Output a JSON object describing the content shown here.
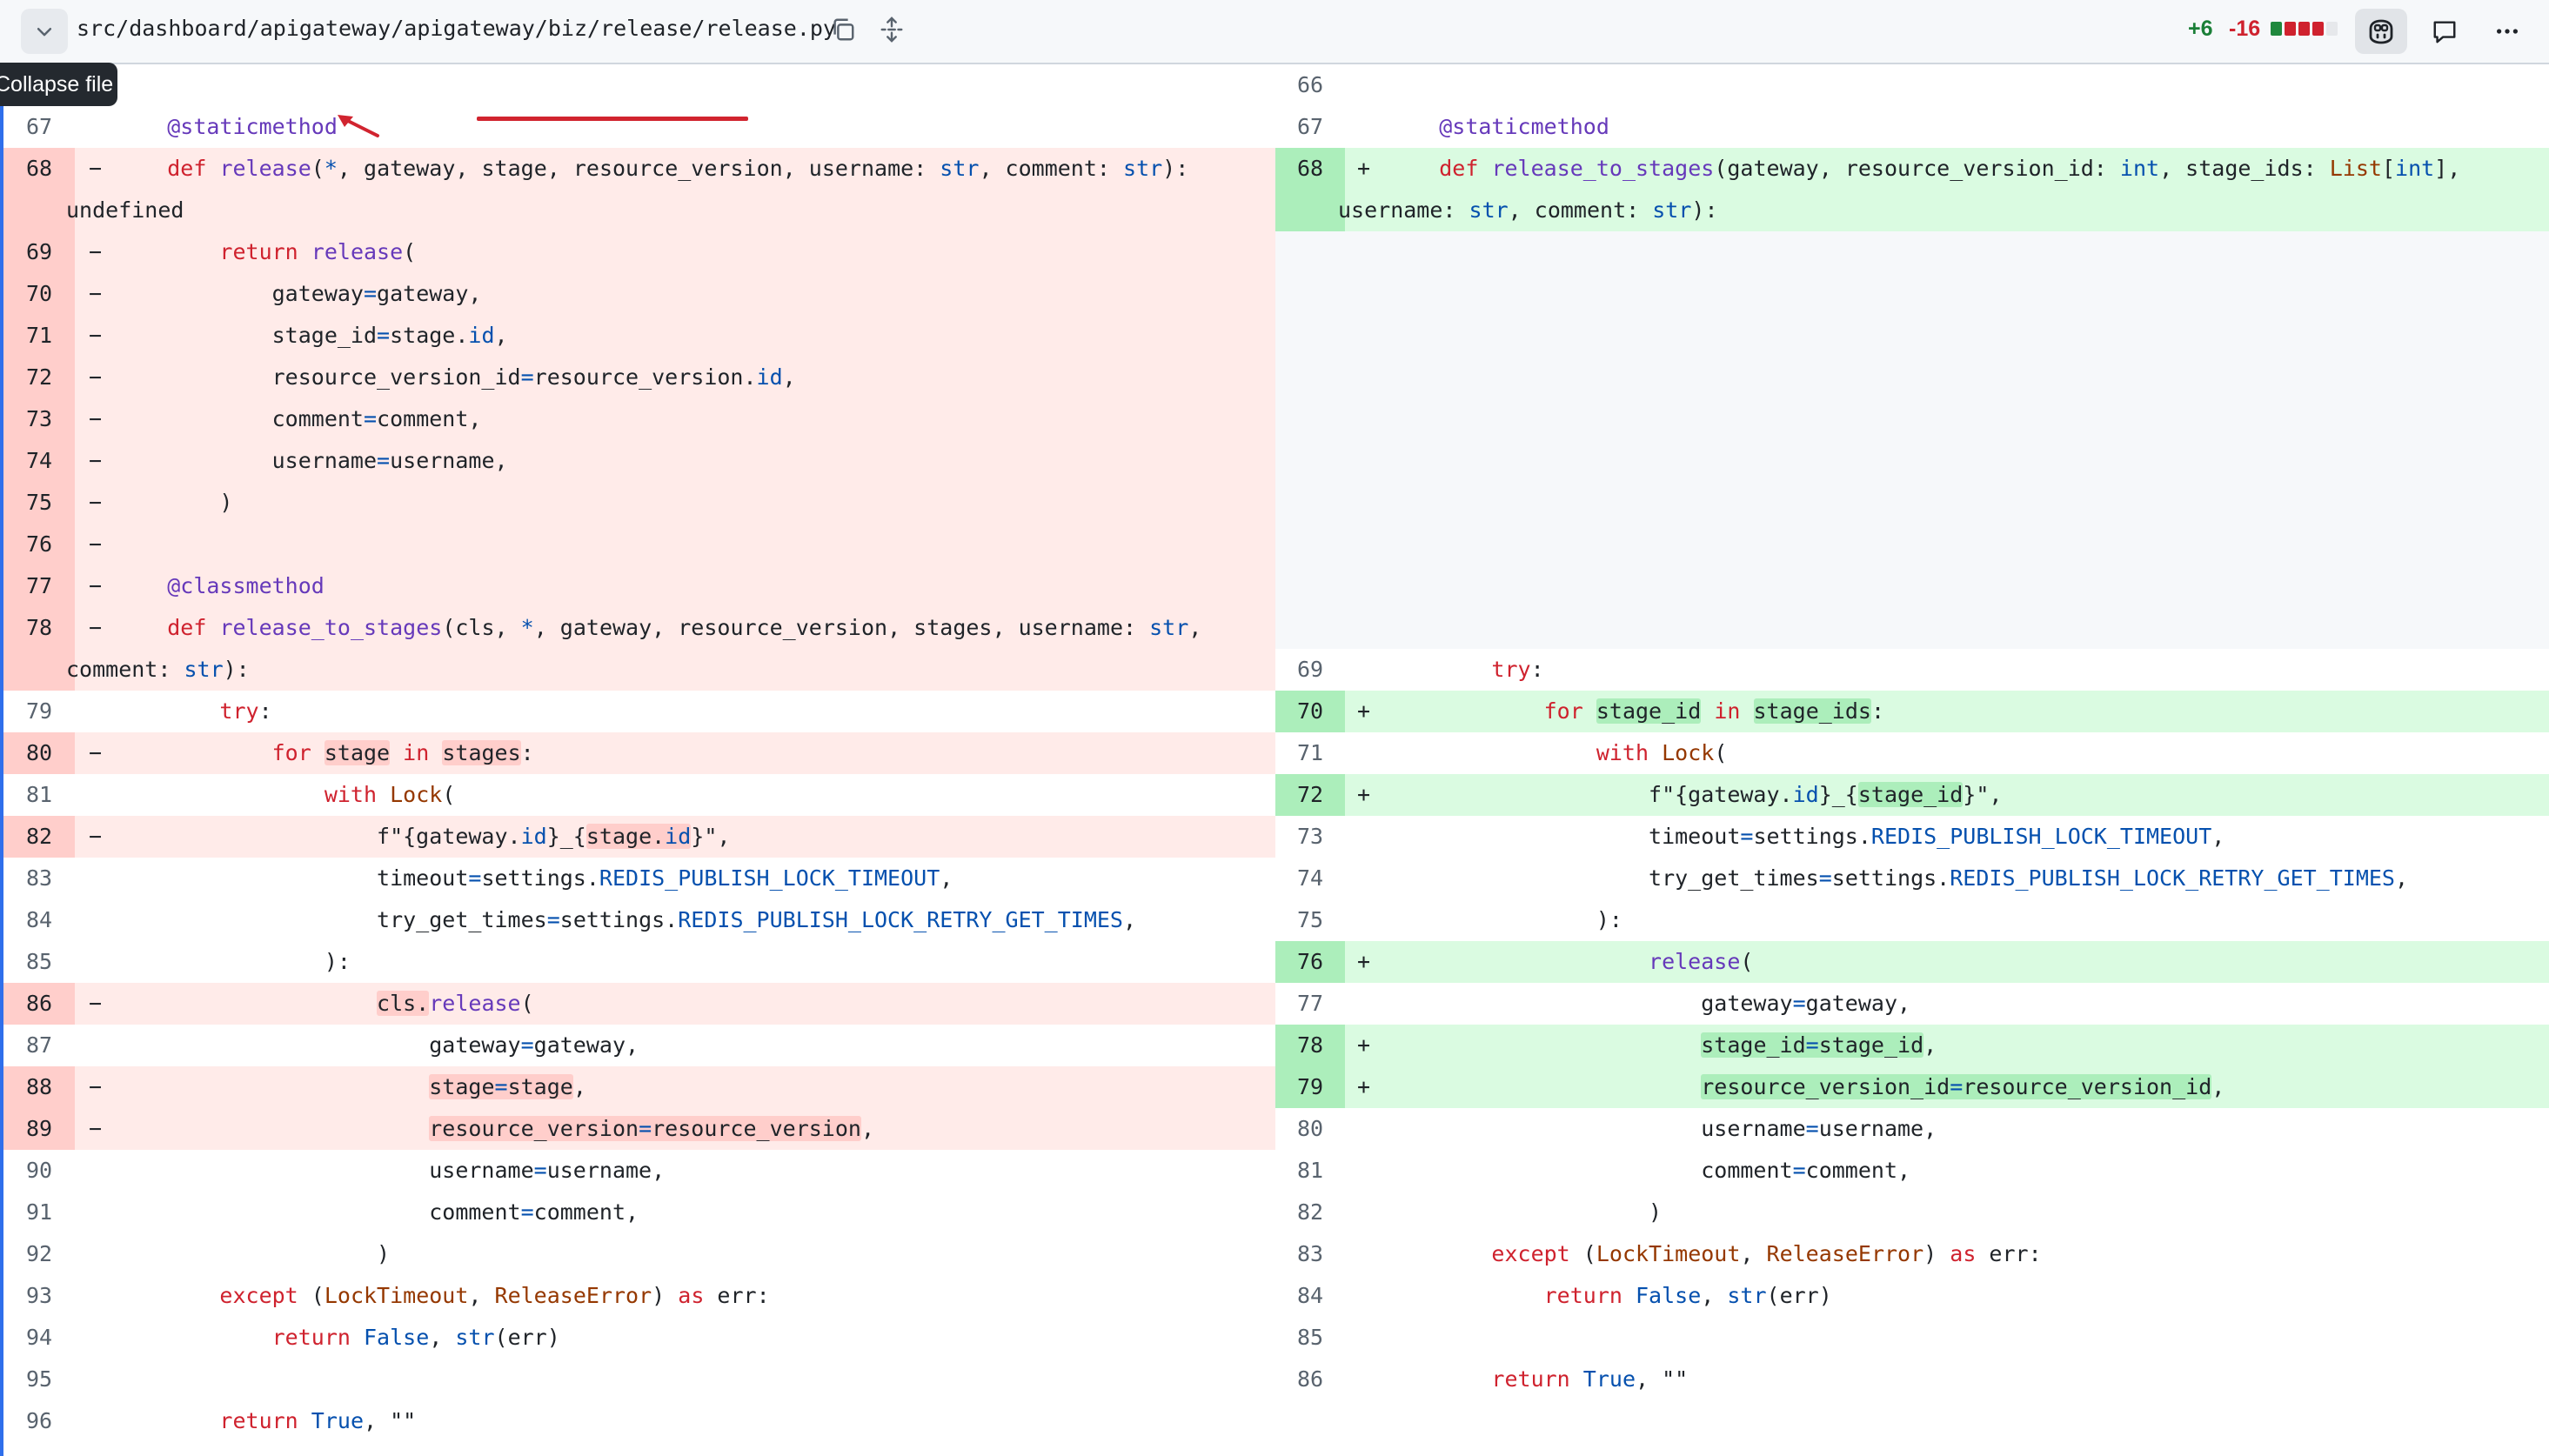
{
  "header": {
    "file_path": "src/dashboard/apigateway/apigateway/biz/release/release.py",
    "additions": "+6",
    "deletions": "-16",
    "tooltip": "Collapse file"
  },
  "left": [
    {
      "n": "",
      "m": "",
      "c": "",
      "t": "ctx"
    },
    {
      "n": "67",
      "m": "",
      "c": "    @staticmethod",
      "t": "ctx"
    },
    {
      "n": "68",
      "m": "−",
      "c": "    def release(*, gateway, stage, resource_version, username: str, comment: str):",
      "t": "del",
      "tall": true
    },
    {
      "n": "69",
      "m": "−",
      "c": "        return release(",
      "t": "del"
    },
    {
      "n": "70",
      "m": "−",
      "c": "            gateway=gateway,",
      "t": "del"
    },
    {
      "n": "71",
      "m": "−",
      "c": "            stage_id=stage.id,",
      "t": "del"
    },
    {
      "n": "72",
      "m": "−",
      "c": "            resource_version_id=resource_version.id,",
      "t": "del"
    },
    {
      "n": "73",
      "m": "−",
      "c": "            comment=comment,",
      "t": "del"
    },
    {
      "n": "74",
      "m": "−",
      "c": "            username=username,",
      "t": "del"
    },
    {
      "n": "75",
      "m": "−",
      "c": "        )",
      "t": "del"
    },
    {
      "n": "76",
      "m": "−",
      "c": "",
      "t": "del"
    },
    {
      "n": "77",
      "m": "−",
      "c": "    @classmethod",
      "t": "del"
    },
    {
      "n": "78",
      "m": "−",
      "c": "    def release_to_stages(cls, *, gateway, resource_version, stages, username: str,\ncomment: str):",
      "t": "del",
      "tall": true
    },
    {
      "n": "79",
      "m": "",
      "c": "        try:",
      "t": "ctx"
    },
    {
      "n": "80",
      "m": "−",
      "c": "            for stage in stages:",
      "t": "del"
    },
    {
      "n": "81",
      "m": "",
      "c": "                with Lock(",
      "t": "ctx"
    },
    {
      "n": "82",
      "m": "−",
      "c": "                    f\"{gateway.id}_{stage.id}\",",
      "t": "del"
    },
    {
      "n": "83",
      "m": "",
      "c": "                    timeout=settings.REDIS_PUBLISH_LOCK_TIMEOUT,",
      "t": "ctx"
    },
    {
      "n": "84",
      "m": "",
      "c": "                    try_get_times=settings.REDIS_PUBLISH_LOCK_RETRY_GET_TIMES,",
      "t": "ctx"
    },
    {
      "n": "85",
      "m": "",
      "c": "                ):",
      "t": "ctx"
    },
    {
      "n": "86",
      "m": "−",
      "c": "                    cls.release(",
      "t": "del"
    },
    {
      "n": "87",
      "m": "",
      "c": "                        gateway=gateway,",
      "t": "ctx"
    },
    {
      "n": "88",
      "m": "−",
      "c": "                        stage=stage,",
      "t": "del"
    },
    {
      "n": "89",
      "m": "−",
      "c": "                        resource_version=resource_version,",
      "t": "del"
    },
    {
      "n": "90",
      "m": "",
      "c": "                        username=username,",
      "t": "ctx"
    },
    {
      "n": "91",
      "m": "",
      "c": "                        comment=comment,",
      "t": "ctx"
    },
    {
      "n": "92",
      "m": "",
      "c": "                    )",
      "t": "ctx"
    },
    {
      "n": "93",
      "m": "",
      "c": "        except (LockTimeout, ReleaseError) as err:",
      "t": "ctx"
    },
    {
      "n": "94",
      "m": "",
      "c": "            return False, str(err)",
      "t": "ctx"
    },
    {
      "n": "95",
      "m": "",
      "c": "",
      "t": "ctx"
    },
    {
      "n": "96",
      "m": "",
      "c": "        return True, \"\"",
      "t": "ctx"
    }
  ],
  "right": [
    {
      "n": "66",
      "m": "",
      "c": "",
      "t": "ctx"
    },
    {
      "n": "67",
      "m": "",
      "c": "    @staticmethod",
      "t": "ctx"
    },
    {
      "n": "68",
      "m": "+",
      "c": "    def release_to_stages(gateway, resource_version_id: int, stage_ids: List[int],\nusername: str, comment: str):",
      "t": "add",
      "tall": true,
      "spacer_after": 10
    },
    {
      "n": "69",
      "m": "",
      "c": "        try:",
      "t": "ctx"
    },
    {
      "n": "70",
      "m": "+",
      "c": "            for stage_id in stage_ids:",
      "t": "add"
    },
    {
      "n": "71",
      "m": "",
      "c": "                with Lock(",
      "t": "ctx"
    },
    {
      "n": "72",
      "m": "+",
      "c": "                    f\"{gateway.id}_{stage_id}\",",
      "t": "add"
    },
    {
      "n": "73",
      "m": "",
      "c": "                    timeout=settings.REDIS_PUBLISH_LOCK_TIMEOUT,",
      "t": "ctx"
    },
    {
      "n": "74",
      "m": "",
      "c": "                    try_get_times=settings.REDIS_PUBLISH_LOCK_RETRY_GET_TIMES,",
      "t": "ctx"
    },
    {
      "n": "75",
      "m": "",
      "c": "                ):",
      "t": "ctx"
    },
    {
      "n": "76",
      "m": "+",
      "c": "                    release(",
      "t": "add"
    },
    {
      "n": "77",
      "m": "",
      "c": "                        gateway=gateway,",
      "t": "ctx"
    },
    {
      "n": "78",
      "m": "+",
      "c": "                        stage_id=stage_id,",
      "t": "add"
    },
    {
      "n": "79",
      "m": "+",
      "c": "                        resource_version_id=resource_version_id,",
      "t": "add"
    },
    {
      "n": "80",
      "m": "",
      "c": "                        username=username,",
      "t": "ctx"
    },
    {
      "n": "81",
      "m": "",
      "c": "                        comment=comment,",
      "t": "ctx"
    },
    {
      "n": "82",
      "m": "",
      "c": "                    )",
      "t": "ctx"
    },
    {
      "n": "83",
      "m": "",
      "c": "        except (LockTimeout, ReleaseError) as err:",
      "t": "ctx"
    },
    {
      "n": "84",
      "m": "",
      "c": "            return False, str(err)",
      "t": "ctx"
    },
    {
      "n": "85",
      "m": "",
      "c": "",
      "t": "ctx"
    },
    {
      "n": "86",
      "m": "",
      "c": "        return True, \"\"",
      "t": "ctx"
    }
  ],
  "icons": {
    "collapse": "chevron-down-icon",
    "copy": "copy-icon",
    "expand": "unfold-icon",
    "copilot": "copilot-icon",
    "comment": "comment-icon",
    "more": "kebab-horizontal-icon"
  },
  "colors": {
    "deleted_bg": "#ffebe9",
    "added_bg": "#dafbe1",
    "annotation": "#d1242f"
  }
}
